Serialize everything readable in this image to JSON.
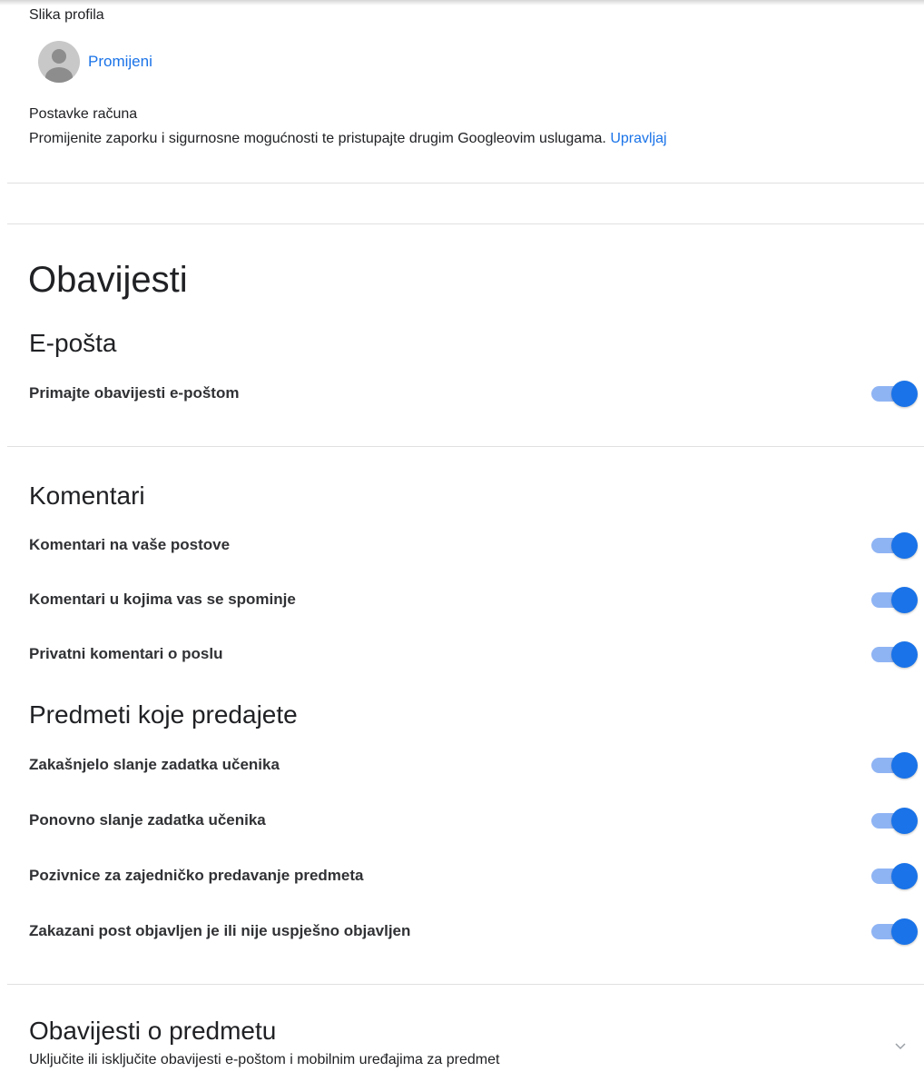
{
  "profile": {
    "photo_label": "Slika profila",
    "change_link": "Promijeni",
    "avatar_icon": "person-avatar-icon"
  },
  "account": {
    "title": "Postavke računa",
    "description": "Promijenite zaporku i sigurnosne mogućnosti te pristupajte drugim Googleovim uslugama.",
    "manage_link": "Upravljaj"
  },
  "notifications": {
    "title": "Obavijesti",
    "email": {
      "heading": "E-pošta",
      "rows": [
        {
          "label": "Primajte obavijesti e-poštom",
          "on": true
        }
      ]
    },
    "comments": {
      "heading": "Komentari",
      "rows": [
        {
          "label": "Komentari na vaše postove",
          "on": true
        },
        {
          "label": "Komentari u kojima vas se spominje",
          "on": true
        },
        {
          "label": "Privatni komentari o poslu",
          "on": true
        }
      ]
    },
    "classes_taught": {
      "heading": "Predmeti koje predajete",
      "rows": [
        {
          "label": "Zakašnjelo slanje zadatka učenika",
          "on": true
        },
        {
          "label": "Ponovno slanje zadatka učenika",
          "on": true
        },
        {
          "label": "Pozivnice za zajedničko predavanje predmeta",
          "on": true
        },
        {
          "label": "Zakazani post objavljen je ili nije uspješno objavljen",
          "on": true
        }
      ]
    },
    "class_notifications": {
      "heading": "Obavijesti o predmetu",
      "description": "Uključite ili isključite obavijesti e-poštom i mobilnim uređajima za predmet",
      "expand_icon": "chevron-down-icon"
    }
  },
  "colors": {
    "accent": "#1a73e8",
    "toggle_track": "#8fb4f4",
    "divider": "#e0e0e0"
  }
}
